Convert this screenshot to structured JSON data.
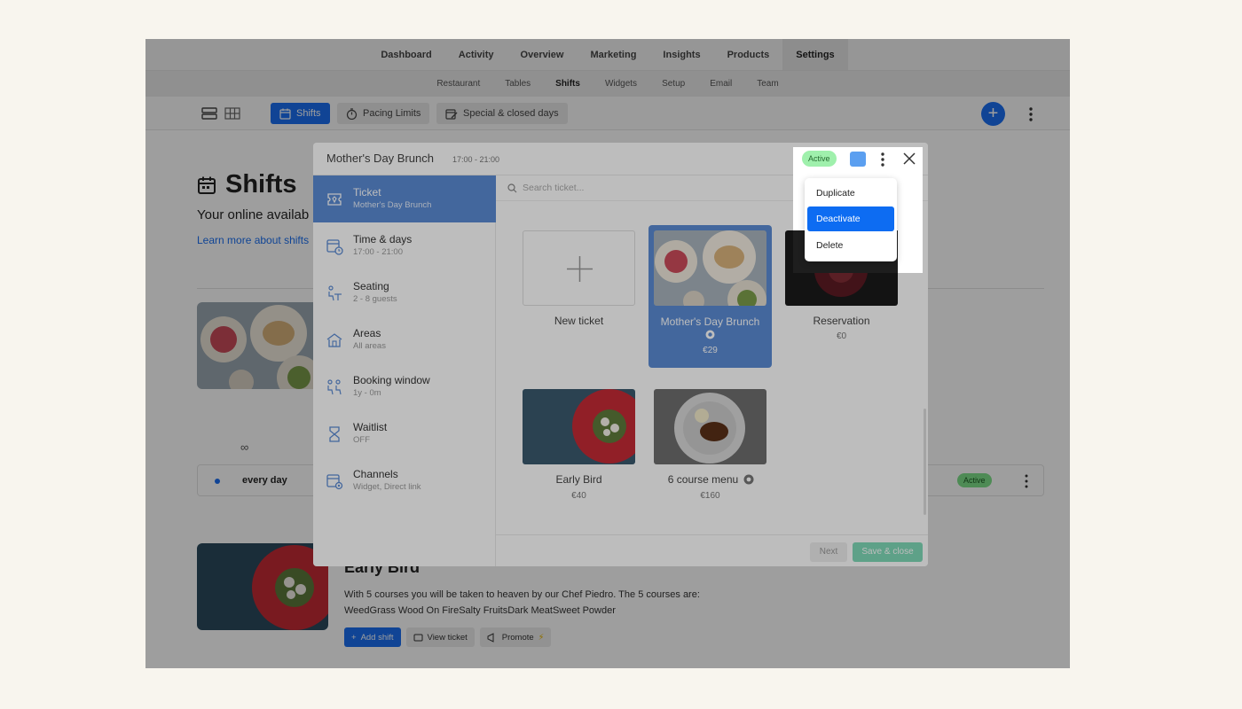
{
  "top_nav": {
    "items": [
      "Dashboard",
      "Activity",
      "Overview",
      "Marketing",
      "Insights",
      "Products",
      "Settings"
    ],
    "active": "Settings"
  },
  "sub_nav": {
    "items": [
      "Restaurant",
      "Tables",
      "Shifts",
      "Widgets",
      "Setup",
      "Email",
      "Team"
    ],
    "active": "Shifts"
  },
  "toolbar": {
    "shifts_label": "Shifts",
    "pacing_label": "Pacing Limits",
    "special_label": "Special & closed days",
    "add_icon": "+"
  },
  "page": {
    "title": "Shifts",
    "subtitle": "Your online availab",
    "learn_more": "Learn more about shifts",
    "repeat_icon": "∞",
    "shift_row": {
      "label": "every day",
      "status": "Active"
    },
    "early_bird": {
      "title": "Early Bird",
      "desc_line1": "With 5 courses you will be taken to heaven by our Chef Piedro. The 5 courses are:",
      "desc_line2": "WeedGrass Wood On FireSalty FruitsDark MeatSweet Powder",
      "add_shift": "Add shift",
      "view_ticket": "View ticket",
      "promote": "Promote"
    }
  },
  "modal": {
    "title": "Mother's Day Brunch",
    "time": "17:00 - 21:00",
    "status": "Active",
    "color": "#5b9ff0",
    "nav": [
      {
        "label": "Ticket",
        "sub": "Mother's Day Brunch",
        "icon": "ticket-icon"
      },
      {
        "label": "Time & days",
        "sub": "17:00 - 21:00",
        "icon": "calendar-clock-icon"
      },
      {
        "label": "Seating",
        "sub": "2 - 8 guests",
        "icon": "seating-icon"
      },
      {
        "label": "Areas",
        "sub": "All areas",
        "icon": "area-icon"
      },
      {
        "label": "Booking window",
        "sub": "1y - 0m",
        "icon": "booking-window-icon"
      },
      {
        "label": "Waitlist",
        "sub": "OFF",
        "icon": "hourglass-icon"
      },
      {
        "label": "Channels",
        "sub": "Widget, Direct link",
        "icon": "channels-icon"
      }
    ],
    "search_placeholder": "Search ticket...",
    "tickets": [
      {
        "name": "New ticket",
        "price": ""
      },
      {
        "name": "Mother's Day Brunch",
        "price": "€29",
        "selected": true
      },
      {
        "name": "Reservation",
        "price": "€0"
      },
      {
        "name": "Early Bird",
        "price": "€40"
      },
      {
        "name": "6 course menu",
        "price": "€160"
      }
    ],
    "next_label": "Next",
    "save_label": "Save & close"
  },
  "dropdown": {
    "items": [
      "Duplicate",
      "Deactivate",
      "Delete"
    ],
    "active": "Deactivate"
  },
  "colors": {
    "accent": "#1a6ff0",
    "selected_card": "#5b8bd4",
    "active_badge": "#9ff0ac",
    "save_button": "#7fd9b8"
  }
}
